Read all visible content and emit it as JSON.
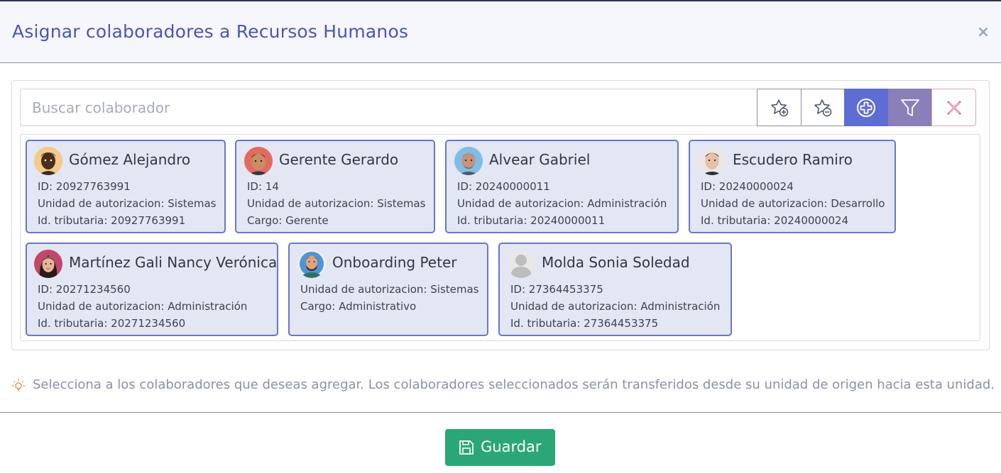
{
  "modal": {
    "title": "Asignar colaboradores a Recursos Humanos",
    "close_label": "×"
  },
  "search": {
    "placeholder": "Buscar colaborador",
    "value": ""
  },
  "toolbar": {
    "buttons": [
      "add-favorite-icon",
      "remove-favorite-icon",
      "add-circle-icon",
      "filter-icon",
      "clear-icon"
    ]
  },
  "collaborators": [
    {
      "name": "Gómez Alejandro",
      "lines": [
        "ID: 20927763991",
        "Unidad de autorizacion: Sistemas",
        "Id. tributaria: 20927763991"
      ]
    },
    {
      "name": "Gerente Gerardo",
      "lines": [
        "ID: 14",
        "Unidad de autorizacion: Sistemas",
        "Cargo: Gerente"
      ]
    },
    {
      "name": "Alvear Gabriel",
      "lines": [
        "ID: 20240000011",
        "Unidad de autorizacion: Administración",
        "Id. tributaria: 20240000011"
      ]
    },
    {
      "name": "Escudero Ramiro",
      "lines": [
        "ID: 20240000024",
        "Unidad de autorizacion: Desarrollo",
        "Id. tributaria: 20240000024"
      ]
    },
    {
      "name": "Martínez Gali Nancy Verónica",
      "lines": [
        "ID: 20271234560",
        "Unidad de autorizacion: Administración",
        "Id. tributaria: 20271234560"
      ]
    },
    {
      "name": "Onboarding Peter",
      "lines": [
        "Unidad de autorizacion: Sistemas",
        "Cargo: Administrativo"
      ]
    },
    {
      "name": "Molda Sonia Soledad",
      "lines": [
        "ID: 27364453375",
        "Unidad de autorizacion: Administración",
        "Id. tributaria: 27364453375"
      ]
    }
  ],
  "hint": {
    "icon": "lightbulb-icon",
    "text": "Selecciona a los colaboradores que deseas agregar. Los colaboradores seleccionados serán transferidos desde su unidad de origen hacia esta unidad."
  },
  "footer": {
    "save_label": "Guardar"
  },
  "colors": {
    "title": "#4a56b6",
    "card_bg": "#e3e6f3",
    "card_border": "#6a77c8",
    "primary_button": "#5d6dd4",
    "filter_button": "#8a7fb8",
    "save_button": "#2aa775"
  }
}
